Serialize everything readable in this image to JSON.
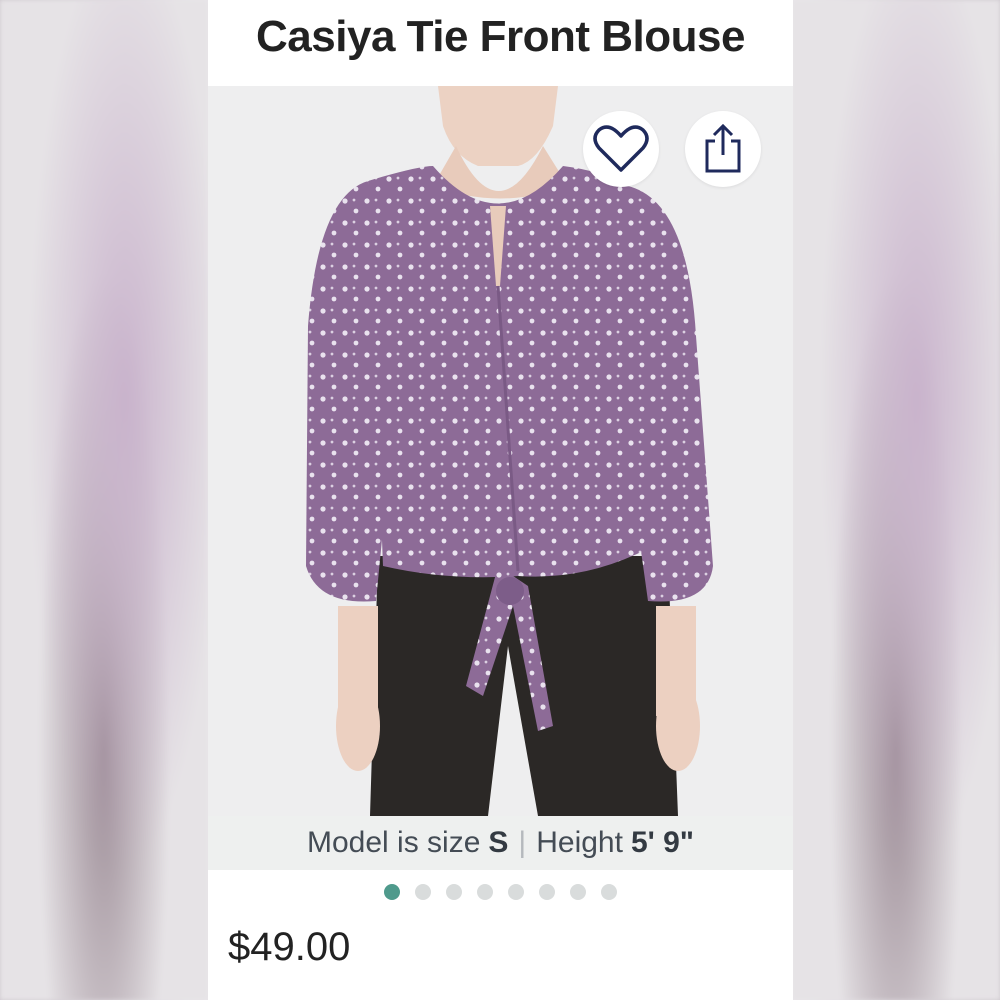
{
  "product": {
    "title": "Casiya Tie Front Blouse",
    "price": "$49.00"
  },
  "model_info": {
    "size_prefix": "Model is size",
    "size_value": "S",
    "separator": "|",
    "height_prefix": "Height",
    "height_value": "5' 9\""
  },
  "carousel": {
    "total_images": 8,
    "active_index": 0,
    "active_color": "#4f9a8c",
    "inactive_color": "#d9dcdc"
  },
  "actions": {
    "favorite_icon": "heart-outline-icon",
    "share_icon": "share-upload-icon",
    "icon_color": "#1f2a5c"
  },
  "colors": {
    "blouse": "#8d6b97",
    "pants": "#2b2826",
    "skin": "#f0d6c8"
  }
}
